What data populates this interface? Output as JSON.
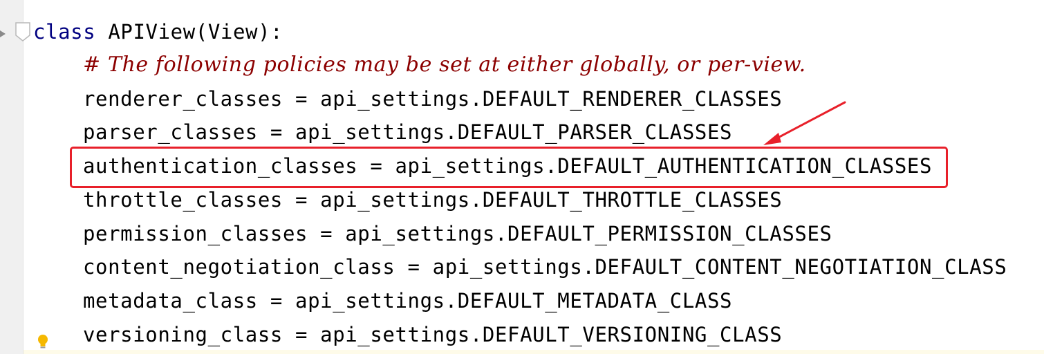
{
  "editor": {
    "lines": [
      {
        "text": "class APIView(View):"
      },
      {
        "text": "# The following policies may be set at either globally, or per-view."
      },
      {
        "text": "renderer_classes = api_settings.DEFAULT_RENDERER_CLASSES"
      },
      {
        "text": "parser_classes = api_settings.DEFAULT_PARSER_CLASSES"
      },
      {
        "text": "authentication_classes = api_settings.DEFAULT_AUTHENTICATION_CLASSES"
      },
      {
        "text": "throttle_classes = api_settings.DEFAULT_THROTTLE_CLASSES"
      },
      {
        "text": "permission_classes = api_settings.DEFAULT_PERMISSION_CLASSES"
      },
      {
        "text": "content_negotiation_class = api_settings.DEFAULT_CONTENT_NEGOTIATION_CLASS"
      },
      {
        "text": "metadata_class = api_settings.DEFAULT_METADATA_CLASS"
      },
      {
        "text": "versioning_class = api_settings.DEFAULT_VERSIONING_CLASS"
      }
    ],
    "keyword": "class",
    "class_decl_rest": " APIView(View):",
    "highlighted_line_index": 4
  },
  "colors": {
    "keyword": "#000080",
    "comment": "#8c0000",
    "annotation": "#e8202a",
    "bulb": "#f5b800"
  },
  "icons": {
    "fold": "fold-marker-icon",
    "bulb": "lightbulb-icon",
    "arrow": "annotation-arrow-icon"
  }
}
